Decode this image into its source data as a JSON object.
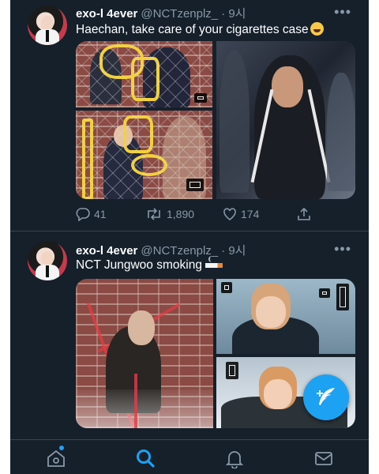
{
  "tweets": [
    {
      "display_name": "exo-l 4ever",
      "handle": "@NCTzenplz_",
      "time": "· 9시",
      "text": "Haechan, take care of your cigarettes case",
      "emoji": "rolling-on-floor-laughing",
      "replies": "41",
      "retweets": "1,890",
      "likes": "174"
    },
    {
      "display_name": "exo-l 4ever",
      "handle": "@NCTzenplz_",
      "time": "· 9시",
      "text": "NCT Jungwoo smoking",
      "emoji": "cigarette"
    }
  ],
  "more_label": "•••",
  "nav": [
    "home-icon",
    "search-icon",
    "notifications-icon",
    "messages-icon"
  ],
  "colors": {
    "background": "#15202b",
    "accent": "#1da1f2",
    "muted": "#8899a6",
    "divider": "#38444d"
  }
}
